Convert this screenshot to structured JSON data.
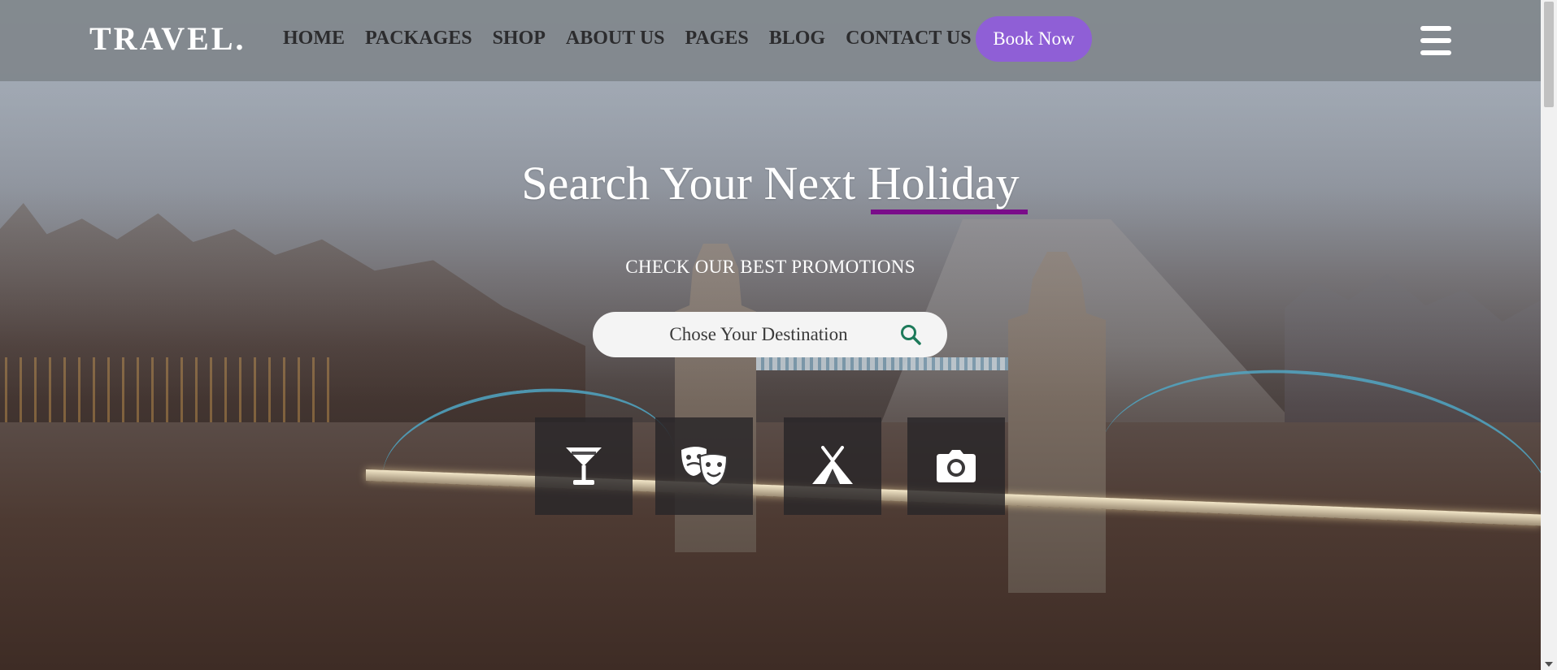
{
  "brand": {
    "logo_text": "TRAVEL."
  },
  "nav": {
    "items": [
      {
        "label": "HOME"
      },
      {
        "label": "PACKAGES"
      },
      {
        "label": "SHOP"
      },
      {
        "label": "ABOUT US"
      },
      {
        "label": "PAGES"
      },
      {
        "label": "BLOG"
      },
      {
        "label": "CONTACT US"
      }
    ],
    "cta_label": "Book Now",
    "cta_color": "#8f5fd6",
    "menu_icon": "hamburger-menu-icon"
  },
  "hero": {
    "title": "Search Your Next Holiday",
    "underline_color": "#7a0d8a",
    "subtitle": "CHECK OUR BEST PROMOTIONS",
    "search": {
      "placeholder": "Chose Your Destination",
      "icon": "search-icon",
      "icon_color": "#1d7a5a"
    },
    "activity_tiles": [
      {
        "icon": "cocktail-glass-icon"
      },
      {
        "icon": "theater-masks-icon"
      },
      {
        "icon": "camping-tent-icon"
      },
      {
        "icon": "camera-icon"
      }
    ]
  }
}
